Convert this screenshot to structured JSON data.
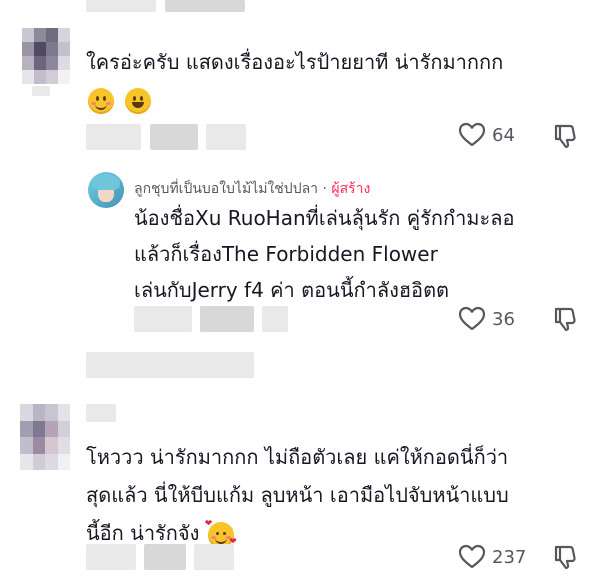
{
  "comments": [
    {
      "text_lines": [
        "ใครอ่ะครับ แสดงเรื่องอะไรป้ายยาที น่ารักมากกก"
      ],
      "emojis": [
        "smiling-face-icon",
        "grinning-face-icon"
      ],
      "likes": "64"
    },
    {
      "text_lines": [
        "โหววว น่ารักมากกก ไม่ถือตัวเลย แค่ให้กอดนี่ก็ว่า",
        "สุดแล้ว นี่ให้บีบแก้ม ลูบหน้า เอามือไปจับหน้าแบบ",
        "นี้อีก น่ารักจัง"
      ],
      "emoji": "smiling-face-with-hearts-icon",
      "likes": "237"
    }
  ],
  "reply": {
    "username": "ลูกชุบที่เป็นบอใบไม้ไม่ใช่ปปลา",
    "separator": "·",
    "badge": "ผู้สร้าง",
    "text_lines": [
      "น้องชื่อXu RuoHanที่เล่นลุ้นรัก คู่รักกำมะลอ",
      "แล้วก็เรื่องThe Forbidden Flower",
      "เล่นกับJerry f4 ค่า ตอนนี้กำลังฮอิตต"
    ],
    "likes": "36"
  },
  "colors": {
    "text": "#161823",
    "muted": "#57585f",
    "creator": "#fe2c55"
  }
}
